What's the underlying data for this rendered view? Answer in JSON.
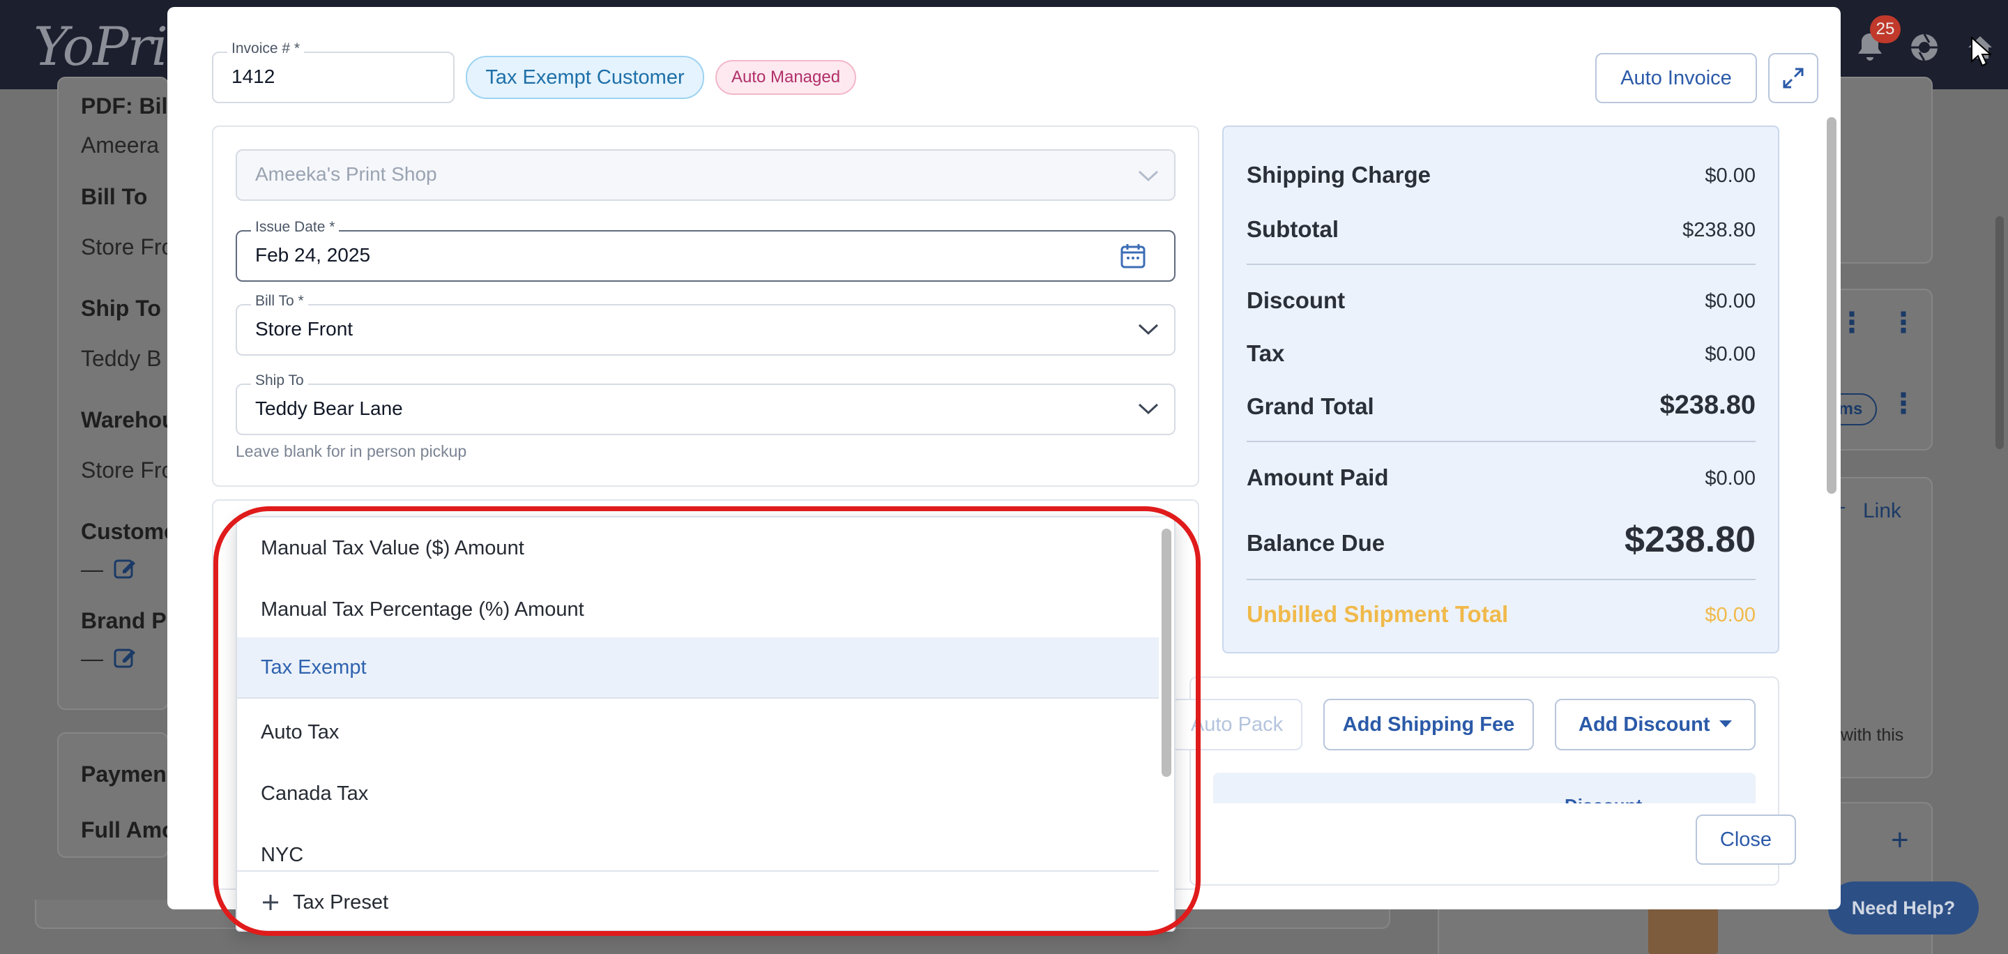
{
  "app": {
    "logo_text": "YoPrint",
    "notification_count": "25"
  },
  "background": {
    "left_card": {
      "pdf_label": "PDF: Bill",
      "customer_name": "Ameera",
      "bill_to_label": "Bill To",
      "bill_to_value": "Store Fro",
      "ship_to_label": "Ship To",
      "ship_to_value": "Teddy B",
      "warehouse_label": "Warehou",
      "warehouse_value": "Store Fro",
      "customer_label": "Custome",
      "customer_value": "—",
      "brand_label": "Brand Pr",
      "brand_value": "—"
    },
    "left_card_2": {
      "payment_label": "Paymen",
      "full_amount_label": "Full Amo"
    },
    "right": {
      "items_tag": "ms",
      "link_label": "Link",
      "with_this_text": "with this",
      "need_help": "Need Help?"
    }
  },
  "modal": {
    "invoice_number": {
      "label": "Invoice # *",
      "value": "1412"
    },
    "tax_exempt_badge": "Tax Exempt Customer",
    "auto_managed_badge": "Auto Managed",
    "auto_invoice_button": "Auto Invoice",
    "shop_select": {
      "value": "Ameeka's Print Shop"
    },
    "issue_date": {
      "label": "Issue Date *",
      "value": "Feb 24, 2025"
    },
    "bill_to": {
      "label": "Bill To *",
      "value": "Store Front"
    },
    "ship_to": {
      "label": "Ship To",
      "value": "Teddy Bear Lane",
      "helper": "Leave blank for in person pickup"
    },
    "summary": {
      "shipping_charge": {
        "label": "Shipping Charge",
        "value": "$0.00"
      },
      "subtotal": {
        "label": "Subtotal",
        "value": "$238.80"
      },
      "discount": {
        "label": "Discount",
        "value": "$0.00"
      },
      "tax": {
        "label": "Tax",
        "value": "$0.00"
      },
      "grand_total": {
        "label": "Grand Total",
        "value": "$238.80"
      },
      "amount_paid": {
        "label": "Amount Paid",
        "value": "$0.00"
      },
      "balance_due": {
        "label": "Balance Due",
        "value": "$238.80"
      },
      "unbilled_shipment": {
        "label": "Unbilled Shipment Total",
        "value": "$0.00"
      }
    },
    "actions": {
      "auto_pack": "Auto Pack",
      "add_shipping_fee": "Add Shipping Fee",
      "add_discount": "Add Discount",
      "table_header_discount": "Discount"
    },
    "close_button": "Close"
  },
  "tax_dropdown": {
    "options": [
      "Manual Tax Value ($) Amount",
      "Manual Tax Percentage (%) Amount",
      "Tax Exempt",
      "Auto Tax",
      "Canada Tax",
      "NYC"
    ],
    "selected": "Tax Exempt",
    "footer_action": "Tax Preset"
  },
  "colors": {
    "accent_blue": "#2e62ae",
    "badge_pink": "#b0306a",
    "unbilled_yellow": "#f0b94a",
    "highlight_red": "#e01b1b"
  }
}
